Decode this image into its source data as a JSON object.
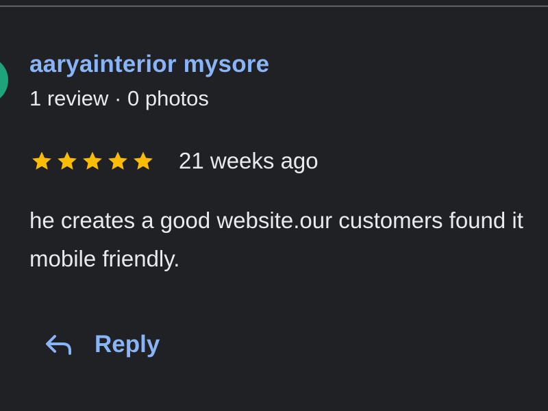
{
  "reviewer": {
    "name": "aaryainterior mysore",
    "meta": "1 review · 0 photos",
    "avatar_color": "#1fa37a"
  },
  "rating": {
    "stars": 5,
    "max_stars": 5,
    "star_color": "#fbbc04",
    "time_ago": "21 weeks ago"
  },
  "review": {
    "text": "he creates a good website.our customers found it mobile friendly."
  },
  "actions": {
    "reply_label": "Reply",
    "reply_icon": "reply-arrow-icon"
  },
  "colors": {
    "background": "#202124",
    "link": "#8ab4f8",
    "text": "#e8eaed"
  }
}
